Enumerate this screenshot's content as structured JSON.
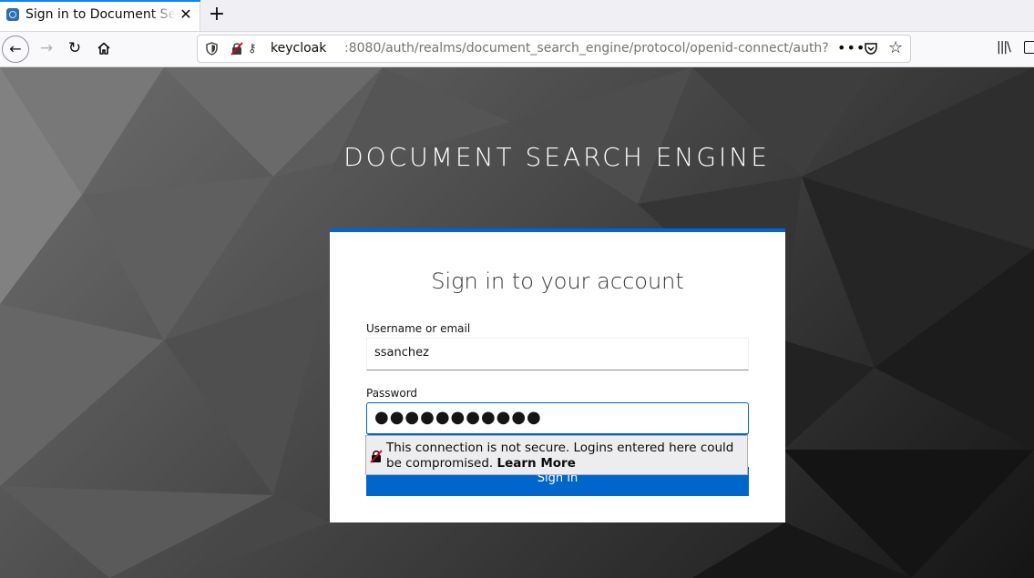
{
  "browser": {
    "tab_title": "Sign in to Document Search Engine",
    "tab_close_icon": "close-icon",
    "new_tab_icon": "plus-icon",
    "url_host": "keycloak",
    "url_rest": ":8080/auth/realms/document_search_engine/protocol/openid-connect/auth?response_type=code",
    "url_more": "•••"
  },
  "page": {
    "brand_title": "DOCUMENT SEARCH ENGINE",
    "card": {
      "heading": "Sign in to your account",
      "username_label": "Username or email",
      "username_value": "ssanchez",
      "password_label": "Password",
      "password_value": "●●●●●●●●●●●",
      "signin_label": "Sign In"
    },
    "warning": {
      "text": "This connection is not secure. Logins entered here could be compromised.",
      "learn_more": "Learn More"
    }
  },
  "colors": {
    "accent": "#0066cc",
    "tab_highlight": "#0a84ff"
  }
}
